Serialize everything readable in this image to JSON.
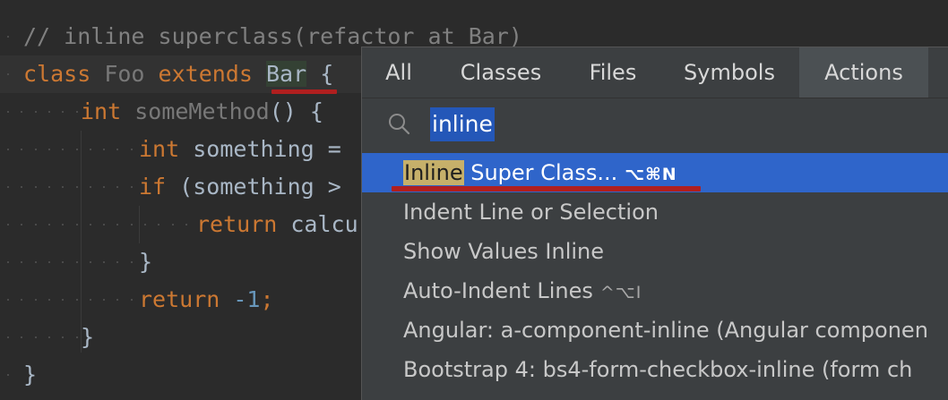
{
  "editor": {
    "comment": "// inline superclass(refactor at Bar)",
    "line_class": {
      "kw_class": "class",
      "name": "Foo",
      "kw_extends": "extends",
      "super": "Bar",
      "brace": "{"
    },
    "line_method": {
      "type": "int",
      "name": "someMethod",
      "rest": "() {"
    },
    "line_decl": {
      "type": "int",
      "rest": "something ="
    },
    "line_if": {
      "kw": "if",
      "rest": "(something >"
    },
    "line_return_call": {
      "kw": "return",
      "rest": "calcu"
    },
    "line_close_inner": "}",
    "line_return_neg": {
      "kw": "return",
      "num": "-1",
      "semi": ";"
    },
    "line_close_method": "}",
    "line_close_class": "}"
  },
  "popup": {
    "tabs": [
      {
        "label": "All"
      },
      {
        "label": "Classes"
      },
      {
        "label": "Files"
      },
      {
        "label": "Symbols"
      },
      {
        "label": "Actions",
        "active": true
      }
    ],
    "search": {
      "value": "inline",
      "icon": "search-icon"
    },
    "results": [
      {
        "match": "Inline",
        "label": " Super Class...",
        "shortcut": "⌥⌘N",
        "selected": true
      },
      {
        "label": "Indent Line or Selection"
      },
      {
        "label": "Show Values Inline"
      },
      {
        "label": "Auto-Indent Lines",
        "shortcut": "^⌥I"
      },
      {
        "label": "Angular: a-component-inline (Angular componen"
      },
      {
        "label": "Bootstrap 4: bs4-form-checkbox-inline (form ch"
      }
    ]
  },
  "colors": {
    "editor_bg": "#2b2b2b",
    "keyword": "#cc7832",
    "comment": "#808080",
    "number": "#6897bb",
    "selection": "#2f65ca",
    "match_highlight": "#c6b06a",
    "error_underline": "#b01f1f"
  }
}
